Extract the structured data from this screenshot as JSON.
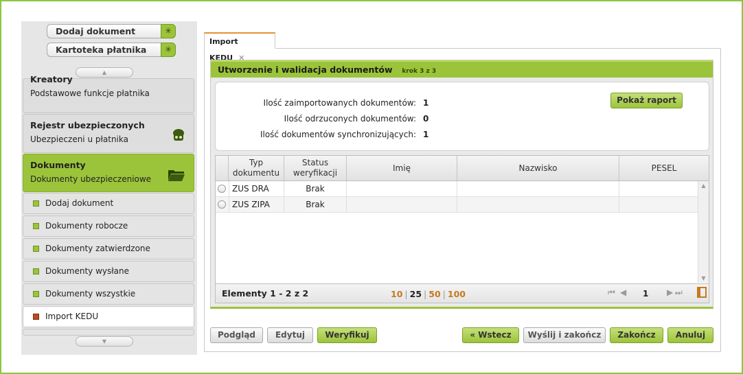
{
  "sidebar": {
    "quick_actions": [
      {
        "label": "Dodaj dokument",
        "icon": "add-wand-icon"
      },
      {
        "label": "Kartoteka płatnika",
        "icon": "add-wand-icon"
      }
    ],
    "scroll_up_icon": "▲",
    "scroll_down_icon": "▼",
    "groups": [
      {
        "title": "Kreatory",
        "subtitle": "Podstawowe funkcje płatnika"
      },
      {
        "title": "Rejestr ubezpieczonych",
        "subtitle": "Ubezpieczeni u płatnika",
        "icon": "people-icon"
      },
      {
        "title": "Dokumenty",
        "subtitle": "Dokumenty ubezpieczeniowe",
        "icon": "folder-icon"
      }
    ],
    "items": [
      {
        "label": "Dodaj dokument"
      },
      {
        "label": "Dokumenty robocze"
      },
      {
        "label": "Dokumenty zatwierdzone"
      },
      {
        "label": "Dokumenty wysłane"
      },
      {
        "label": "Dokumenty wszystkie"
      },
      {
        "label": "Import KEDU"
      }
    ]
  },
  "tab": {
    "label": "Import KEDU",
    "close": "✕"
  },
  "wizard": {
    "title": "Utworzenie i walidacja dokumentów",
    "step": "krok 3 z 3",
    "summary": [
      {
        "label": "Ilość zaimportowanych dokumentów:",
        "value": "1"
      },
      {
        "label": "Ilość odrzuconych dokumentów:",
        "value": "0"
      },
      {
        "label": "Ilość dokumentów synchronizujących:",
        "value": "1"
      }
    ],
    "report_button": "Pokaż raport"
  },
  "table": {
    "columns": [
      {
        "label": "Typ dokumentu"
      },
      {
        "label": "Status weryfikacji"
      },
      {
        "label": "Imię"
      },
      {
        "label": "Nazwisko"
      },
      {
        "label": "PESEL"
      }
    ],
    "rows": [
      {
        "type": "ZUS DRA",
        "status": "Brak",
        "first_name": "",
        "last_name": "",
        "pesel": ""
      },
      {
        "type": "ZUS ZIPA",
        "status": "Brak",
        "first_name": "",
        "last_name": "",
        "pesel": ""
      }
    ],
    "footer": {
      "elements": "Elementy 1 - 2 z 2",
      "page_sizes": [
        "10",
        "25",
        "50",
        "100"
      ],
      "page_size_selected": "25",
      "page": "1",
      "first_icon": "⏮",
      "prev_icon": "◀",
      "next_icon": "▶",
      "last_icon": "⏭"
    }
  },
  "buttons": {
    "preview": "Podgląd",
    "edit": "Edytuj",
    "verify": "Weryfikuj",
    "back": "« Wstecz",
    "send_finish": "Wyślij i zakończ",
    "finish": "Zakończ",
    "cancel": "Anuluj"
  },
  "colors": {
    "accent_green": "#9cc43a",
    "frame_green": "#8cc63f",
    "orange": "#c8781e"
  }
}
